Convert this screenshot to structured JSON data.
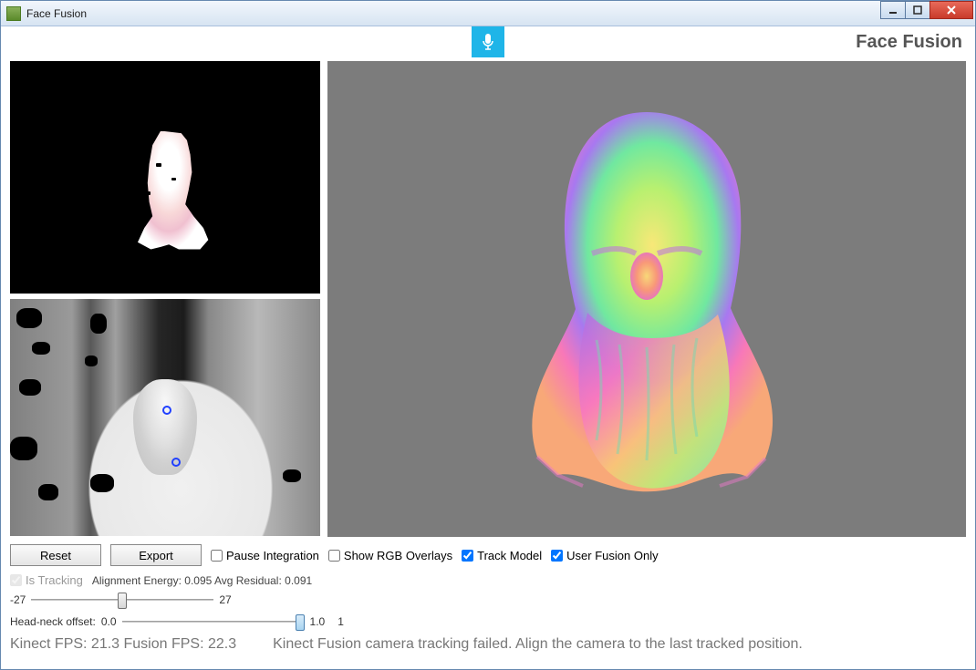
{
  "window": {
    "title": "Face Fusion"
  },
  "header": {
    "app_title": "Face Fusion"
  },
  "buttons": {
    "reset": "Reset",
    "export": "Export"
  },
  "checkboxes": {
    "pause_integration": {
      "label": "Pause Integration",
      "checked": false
    },
    "show_rgb_overlays": {
      "label": "Show RGB Overlays",
      "checked": false
    },
    "track_model": {
      "label": "Track Model",
      "checked": true
    },
    "user_fusion_only": {
      "label": "User Fusion Only",
      "checked": true
    },
    "is_tracking": {
      "label": "Is Tracking",
      "checked": true
    }
  },
  "status": {
    "alignment_energy_label": "Alignment Energy:",
    "alignment_energy_value": "0.095",
    "avg_residual_label": "Avg Residual:",
    "avg_residual_value": "0.091"
  },
  "slider1": {
    "min_label": "-27",
    "max_label": "27",
    "value": 0
  },
  "slider2": {
    "label": "Head-neck offset:",
    "value_label": "0.0",
    "right_value": "1.0",
    "max_label": "1"
  },
  "footer": {
    "fps": "Kinect FPS: 21.3 Fusion FPS: 22.3",
    "message": "Kinect Fusion camera tracking failed. Align the camera to the last tracked position."
  }
}
